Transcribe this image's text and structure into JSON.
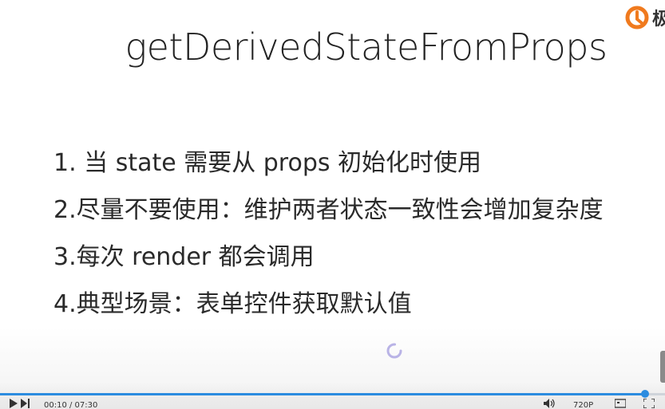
{
  "slide": {
    "title": "getDerivedStateFromProps",
    "bullets": [
      "1. 当 state 需要从 props 初始化时使用",
      "2.尽量不要使用：维护两者状态一致性会增加复杂度",
      "3.每次 render 都会调用",
      "4.典型场景：表单控件获取默认值"
    ]
  },
  "logo": {
    "text": "极",
    "color": "#f07a1e"
  },
  "player": {
    "time": "00:10 / 07:30",
    "quality": "720P",
    "progress": 0.97,
    "accent": "#2b8ce0",
    "icons": [
      "next-icon",
      "volume-icon",
      "fullscreen-icon",
      "loading-spinner-icon"
    ]
  }
}
